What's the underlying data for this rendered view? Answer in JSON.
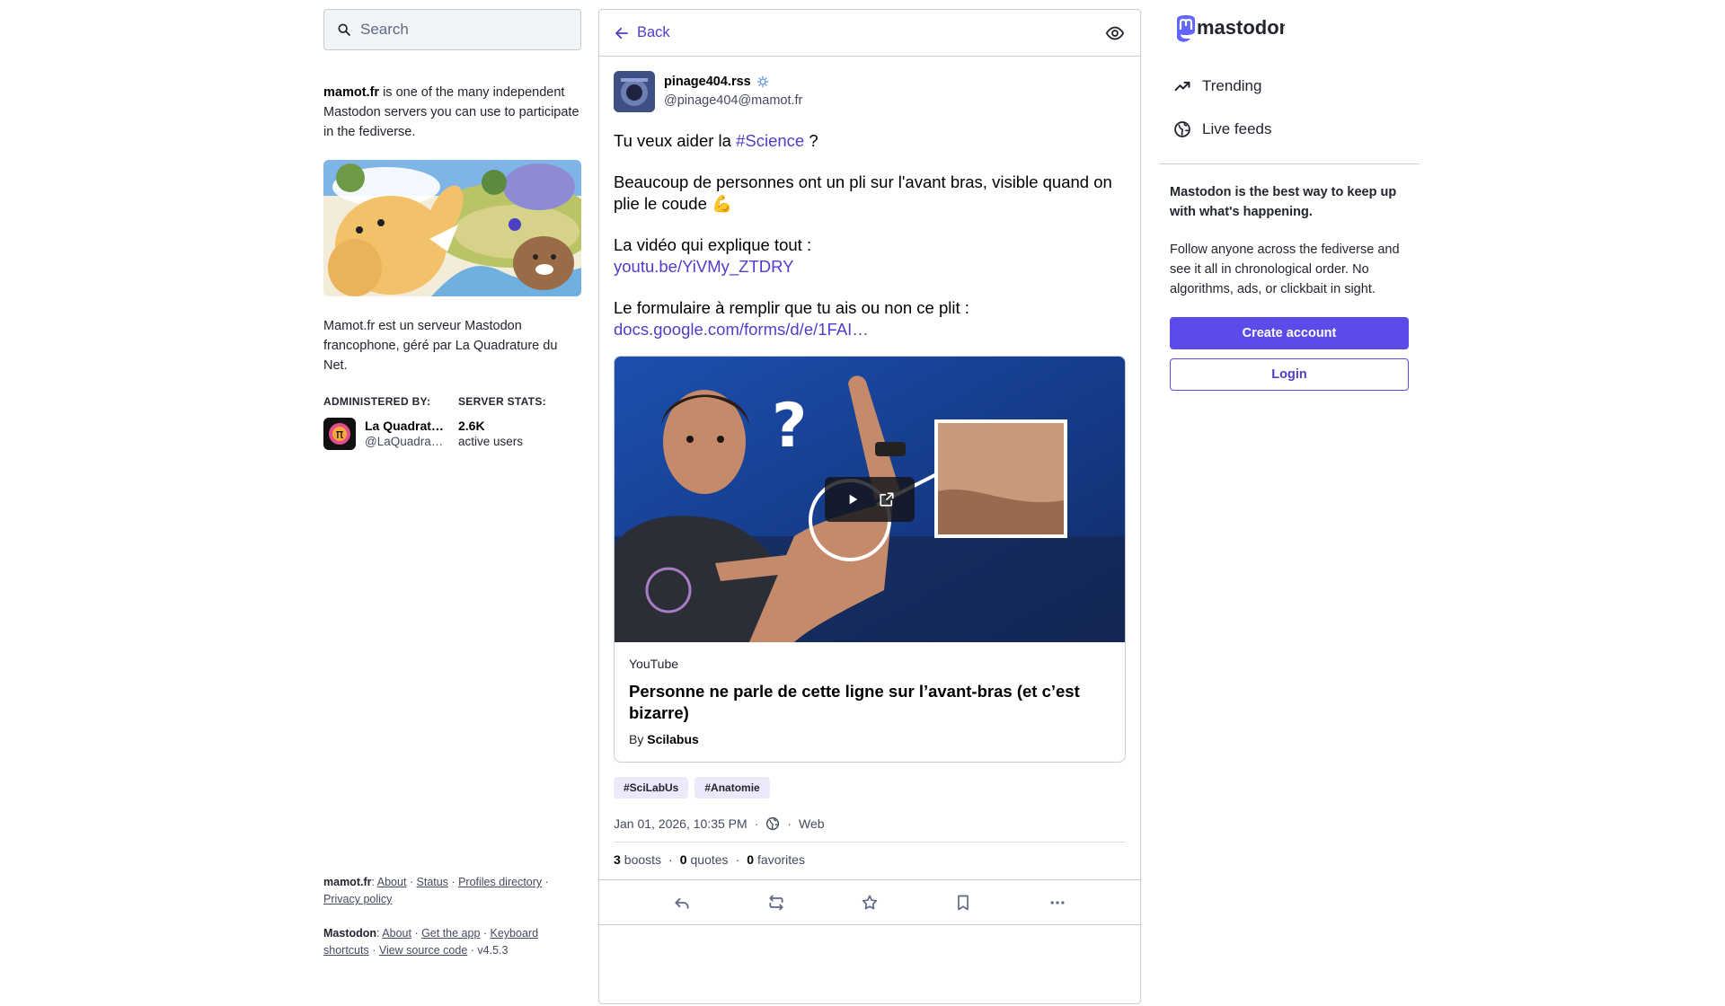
{
  "search": {
    "placeholder": "Search"
  },
  "server": {
    "domain": "mamot.fr",
    "intro_rest": " is one of the many independent Mastodon servers you can use to participate in the fediverse.",
    "description": "Mamot.fr est un serveur Mastodon francophone, géré par La Quadrature du Net.",
    "admin_heading": "ADMINISTERED BY:",
    "admin_name": "La Quadrature du Net",
    "admin_handle": "@LaQuadrature",
    "stats_heading": "SERVER STATS:",
    "active_users_value": "2.6K",
    "active_users_label": "active users"
  },
  "footer": {
    "server_label": "mamot.fr",
    "server_links": [
      "About",
      "Status",
      "Profiles directory",
      "Privacy policy"
    ],
    "mastodon_label": "Mastodon",
    "mastodon_links": [
      "About",
      "Get the app",
      "Keyboard shortcuts",
      "View source code"
    ],
    "version": "v4.5.3"
  },
  "header": {
    "back_label": "Back"
  },
  "status": {
    "display_name": "pinage404.rss",
    "handle": "@pinage404@mamot.fr",
    "paragraphs": {
      "p1_before": "Tu veux aider la ",
      "p1_hashtag": "#Science",
      "p1_after": " ?",
      "p2": "Beaucoup de personnes ont un pli sur l'avant bras, visible quand on plie le coude 💪",
      "p3": "La vidéo qui explique tout :",
      "p3_link": "youtu.be/YiVMy_ZTDRY",
      "p4": "Le formulaire à remplir que tu ais ou non ce plit :",
      "p4_link": "docs.google.com/forms/d/e/1FAI…"
    },
    "card": {
      "provider": "YouTube",
      "title": "Personne ne parle de cette ligne sur l’avant-bras (et c’est bizarre)",
      "author_prefix": "By ",
      "author": "Scilabus"
    },
    "tags": [
      "#SciLabUs",
      "#Anatomie"
    ],
    "date": "Jan 01, 2026, 10:35 PM",
    "application": "Web",
    "boosts_count": "3",
    "boosts_label": "boosts",
    "quotes_count": "0",
    "quotes_label": "quotes",
    "favorites_count": "0",
    "favorites_label": "favorites"
  },
  "sidebar": {
    "logo_text": "mastodon",
    "nav": [
      {
        "label": "Trending",
        "icon": "trending-icon"
      },
      {
        "label": "Live feeds",
        "icon": "globe-icon"
      }
    ],
    "promo_heading": "Mastodon is the best way to keep up with what's happening.",
    "promo_body": "Follow anyone across the fediverse and see it all in chronological order. No algorithms, ads, or clickbait in sight.",
    "create_account_label": "Create account",
    "login_label": "Login"
  },
  "colors": {
    "accent": "#563acc",
    "button_primary": "#5b4be8",
    "tag_background": "#ece9fb"
  }
}
